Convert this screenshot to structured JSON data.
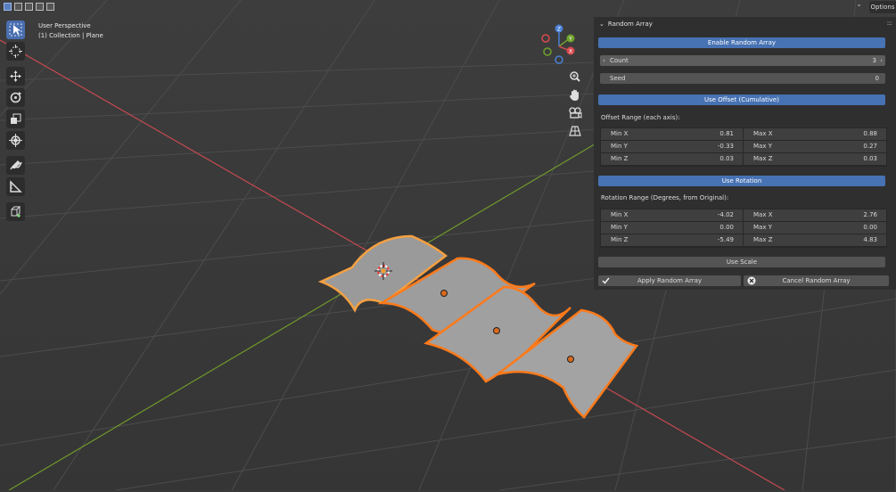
{
  "header": {
    "options_label": "Options",
    "view_name": "User Perspective",
    "collection_info": "(1) Collection | Plane"
  },
  "gizmo": {
    "z": "Z",
    "y": "Y",
    "x": "X"
  },
  "panel": {
    "title": "Random Array",
    "enable_label": "Enable Random Array",
    "count_label": "Count",
    "count_value": "3",
    "seed_label": "Seed",
    "seed_value": "0",
    "use_offset_label": "Use Offset (Cumulative)",
    "offset_range_label": "Offset Range (each axis):",
    "offset": {
      "min_x_label": "Min X",
      "min_x": "0.81",
      "max_x_label": "Max X",
      "max_x": "0.88",
      "min_y_label": "Min Y",
      "min_y": "-0.33",
      "max_y_label": "Max Y",
      "max_y": "0.27",
      "min_z_label": "Min Z",
      "min_z": "0.03",
      "max_z_label": "Max Z",
      "max_z": "0.03"
    },
    "use_rotation_label": "Use Rotation",
    "rotation_range_label": "Rotation Range (Degrees, from Original):",
    "rotation": {
      "min_x_label": "Min X",
      "min_x": "-4.02",
      "max_x_label": "Max X",
      "max_x": "2.76",
      "min_y_label": "Min Y",
      "min_y": "0.00",
      "max_y_label": "Max Y",
      "max_y": "0.00",
      "min_z_label": "Min Z",
      "min_z": "-5.49",
      "max_z_label": "Max Z",
      "max_z": "4.83"
    },
    "use_scale_label": "Use Scale",
    "apply_label": "Apply Random Array",
    "cancel_label": "Cancel Random Array"
  },
  "colors": {
    "accent": "#4772b3",
    "selection_outline": "#ff8c1a",
    "axis_x": "#c64a4f",
    "axis_y": "#6f9a2b"
  }
}
